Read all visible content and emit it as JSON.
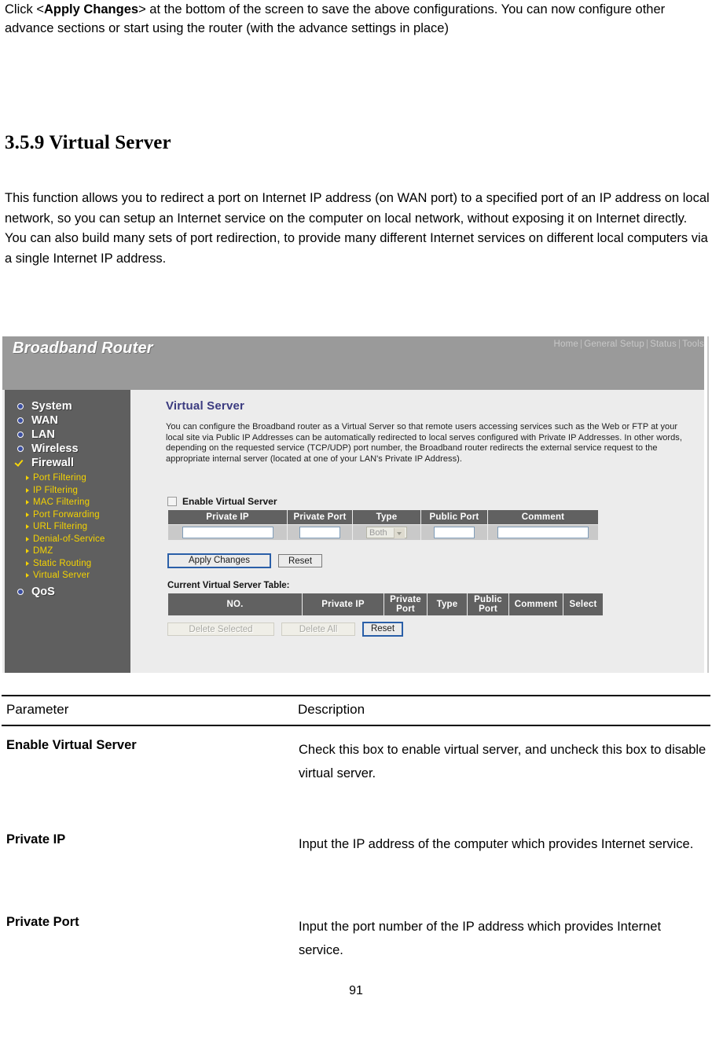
{
  "document": {
    "intro_paragraph_prefix": "Click <",
    "intro_paragraph_bold": "Apply Changes",
    "intro_paragraph_suffix": "> at the bottom of the screen to save the above configurations. You can now configure other advance sections or start using the router (with the advance settings in place)",
    "section_heading": "3.5.9 Virtual Server",
    "description": "This function allows you to redirect a port on Internet IP address (on WAN port) to a specified port of an IP address on local network, so you can setup an Internet service on the computer on local network, without exposing it on Internet directly. You can also build many sets of port redirection, to provide many different Internet services on different local computers via a single Internet IP address.",
    "page_number": "91"
  },
  "router_ui": {
    "brand": "Broadband Router",
    "top_nav": [
      "Home",
      "General Setup",
      "Status",
      "Tools"
    ],
    "top_nav_separator": "|",
    "sidebar": {
      "top_items": [
        {
          "label": "System",
          "active": false
        },
        {
          "label": "WAN",
          "active": false
        },
        {
          "label": "LAN",
          "active": false
        },
        {
          "label": "Wireless",
          "active": false
        },
        {
          "label": "Firewall",
          "active": true
        }
      ],
      "sub_items": [
        "Port Filtering",
        "IP Filtering",
        "MAC Filtering",
        "Port Forwarding",
        "URL Filtering",
        "Denial-of-Service",
        "DMZ",
        "Static Routing",
        "Virtual Server"
      ],
      "last_item": {
        "label": "QoS",
        "active": false
      }
    },
    "content": {
      "title": "Virtual Server",
      "description": "You can configure the Broadband router as a Virtual Server so that remote users accessing services such as the Web or FTP at your local site via Public IP Addresses can be automatically redirected to local serves configured with Private IP Addresses. In other words, depending on the requested service (TCP/UDP) port number, the Broadband router redirects the external service request to the appropriate internal server (located at one of your LAN's Private IP Address).",
      "enable_checkbox_label": "Enable Virtual Server",
      "enable_checkbox_checked": false,
      "form_table": {
        "headers": [
          "Private IP",
          "Private Port",
          "Type",
          "Public Port",
          "Comment"
        ],
        "values": {
          "private_ip": "",
          "private_port": "",
          "type": "Both",
          "public_port": "",
          "comment": ""
        }
      },
      "form_buttons": [
        {
          "label": "Apply Changes",
          "style": "primary",
          "disabled": false
        },
        {
          "label": "Reset",
          "style": "plain",
          "disabled": false
        }
      ],
      "current_table_label": "Current Virtual Server Table:",
      "current_table_headers": [
        "NO.",
        "Private IP",
        "Private Port",
        "Type",
        "Public Port",
        "Comment",
        "Select"
      ],
      "current_table_rows": [],
      "current_table_buttons": [
        {
          "label": "Delete Selected",
          "disabled": true
        },
        {
          "label": "Delete All",
          "disabled": true
        },
        {
          "label": "Reset",
          "disabled": false
        }
      ]
    },
    "colors": {
      "header_bar": "#9a9a9a",
      "sidebar": "#5f5f5f",
      "content_bg": "#ececec",
      "table_header": "#616161",
      "title_text": "#3b3b80",
      "sub_item_text": "#f5d300"
    }
  },
  "param_table": {
    "header_parameter": "Parameter",
    "header_description": "Description",
    "rows": [
      {
        "name": "Enable Virtual Server",
        "description": "Check this box to enable virtual server, and uncheck this box to disable virtual server."
      },
      {
        "name": "Private IP",
        "description": " Input the IP address of the computer which provides Internet service."
      },
      {
        "name": "Private Port",
        "description": "Input the port number of the IP address which provides Internet service."
      }
    ]
  }
}
